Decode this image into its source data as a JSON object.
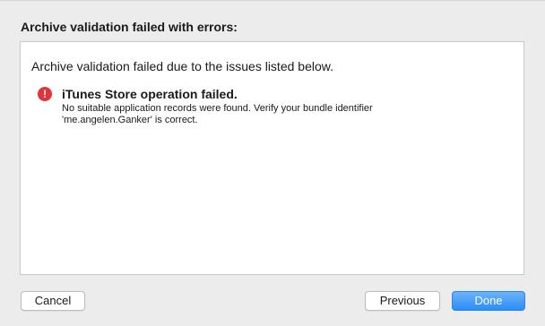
{
  "dialog": {
    "title": "Archive validation failed with errors:",
    "intro": "Archive validation failed due to the issues listed below."
  },
  "issues": [
    {
      "icon": "error-exclamation-icon",
      "title": "iTunes Store operation failed.",
      "detail_line1": "No suitable application records were found. Verify your bundle identifier",
      "detail_line2": "'me.angelen.Ganker' is correct."
    }
  ],
  "buttons": {
    "cancel": "Cancel",
    "previous": "Previous",
    "done": "Done"
  },
  "colors": {
    "error": "#e0343a",
    "primary": "#2a8df8"
  }
}
